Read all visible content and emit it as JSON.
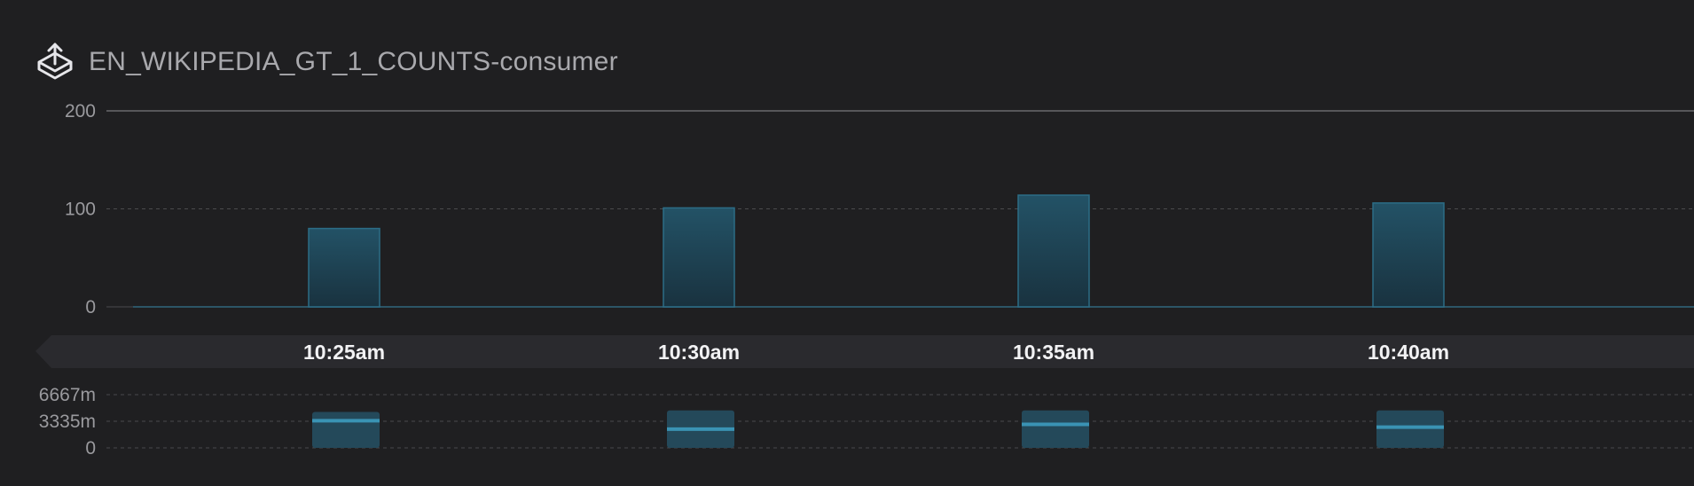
{
  "header": {
    "title": "EN_WIKIPEDIA_GT_1_COUNTS-consumer",
    "icon": "outbox-upload-icon"
  },
  "colors": {
    "background": "#1f1f21",
    "bar_fill": "#1e4658",
    "bar_stroke": "#2c6d86",
    "median_line": "#3a93b4",
    "grid": "#4a4a4d",
    "time_band": "#2a2a2e"
  },
  "chart_data": [
    {
      "type": "bar",
      "categories": [
        "10:25am",
        "10:30am",
        "10:35am",
        "10:40am"
      ],
      "values": [
        80,
        101,
        114,
        106
      ],
      "ylim": [
        0,
        200
      ],
      "yticks": [
        "0",
        "100",
        "200"
      ],
      "grid": true
    },
    {
      "type": "bar",
      "categories": [
        "10:25am",
        "10:30am",
        "10:35am",
        "10:40am"
      ],
      "series": [
        {
          "values": [
            4500,
            4700,
            4700,
            4700
          ]
        },
        {
          "values": [
            3400,
            2350,
            2950,
            2600
          ]
        }
      ],
      "ylim": [
        0,
        6667
      ],
      "yticks": [
        "0",
        "3335m",
        "6667m"
      ],
      "grid": true
    }
  ]
}
